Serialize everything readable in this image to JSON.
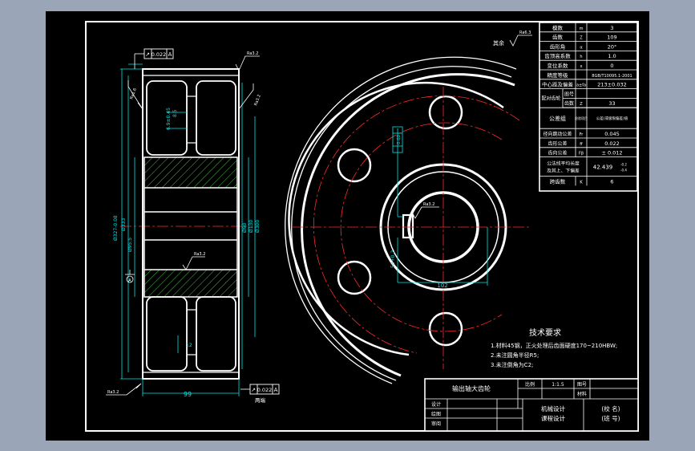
{
  "colors": {
    "background": "#9aa6b7",
    "sheet": "#000000",
    "line": "#ffffff",
    "dimension": "#00e5e5",
    "centerline": "#ff2a2a",
    "hatch": "#3fbf3f",
    "annotation": "#e0e0e0"
  },
  "param_table": {
    "rows": [
      {
        "label": "模数",
        "symbol": "m",
        "value": "3"
      },
      {
        "label": "齿数",
        "symbol": "Z",
        "value": "109"
      },
      {
        "label": "齿形角",
        "symbol": "α",
        "value": "20°"
      },
      {
        "label": "齿顶高系数",
        "symbol": "h",
        "value": "1.0"
      },
      {
        "label": "变位系数",
        "symbol": "x",
        "value": "0"
      },
      {
        "label": "精度等级",
        "symbol": "",
        "value": "8GB/T10095.1-2001"
      },
      {
        "label": "中心距及偏差",
        "symbol": "a±fa",
        "value": "213±0.032"
      }
    ],
    "mating_label": "配对齿轮",
    "mating_rows": [
      {
        "label": "图号",
        "symbol": "",
        "value": ""
      },
      {
        "label": "齿数",
        "symbol": "Z",
        "value": "33"
      }
    ],
    "tolerance_group_label": "公差组",
    "tolerance_group_col": "检验项目",
    "tolerance_group_value": "公差(或极限偏差)值",
    "tol_rows": [
      {
        "label": "径向跳动公差",
        "symbol": "Fr",
        "value": "0.045"
      },
      {
        "label": "齿形公差",
        "symbol": "ff",
        "value": "0.022"
      },
      {
        "label": "齿向公差",
        "symbol": "Fβ",
        "value": "± 0.012"
      }
    ],
    "normal_row_label_1": "公法线平均长度",
    "normal_row_label_2": "及其上、下偏差",
    "normal_row_value": "42.439",
    "normal_row_dev_top": "-0.2",
    "normal_row_dev_bottom": "-0.4",
    "span_row": {
      "label": "跨齿数",
      "symbol": "K",
      "value": "6"
    }
  },
  "tech_requirements": {
    "title": "技术要求",
    "items": [
      "1.材料45钢，正火处理后齿面硬度170~210HBW;",
      "2.未注圆角半径R5;",
      "3.未注倒角为C2;"
    ]
  },
  "title_block": {
    "part_name": "输出轴大齿轮",
    "scale_label": "比例",
    "scale_value": "1:1.5",
    "drawing_no_label": "图号",
    "material_label": "材料",
    "drawn_label": "设计",
    "drawing_label": "绘图",
    "check_label": "审阅",
    "course_1": "机械设计",
    "course_2": "课程设计",
    "school": "(校 名)",
    "class": "(班 号)"
  },
  "annotations": {
    "rest_roughness": "其余",
    "roughness_generic": "Ra3.2",
    "roughness_tooth": "Ra1.6",
    "roughness_3": "Ra6.3",
    "tol_frame_top_symbol": "↗",
    "tol_frame_top_value": "0.022",
    "tol_frame_top_datum": "A",
    "tol_frame_bottom_symbol": "↗",
    "tol_frame_bottom_value": "0.022",
    "tol_frame_bottom_datum": "A",
    "both_sides": "两端",
    "datum_A": "A",
    "width_dim": "99",
    "dia_outer": "Ø333",
    "dia_root": "Ø327",
    "dia_hub1": "Ø130",
    "dia_hub2": "Ø90",
    "dia_bore": "Ø58",
    "dia_pitch": "Ø300",
    "dia_left_1": "Ø327-0.08",
    "dia_left_2": "Ø95.5",
    "side_dim_1": "6.9±0.45",
    "side_dim_2": "8.5",
    "side_dim_3": "12",
    "front_key_tol": "0.068",
    "front_key_dim": "58+0.2",
    "front_key_width": "16",
    "front_bottom_dim": "102",
    "front_runout": "0.02",
    "side_roughness_left": "Ra1.6",
    "side_roughness_mid": "Ra3.2"
  }
}
